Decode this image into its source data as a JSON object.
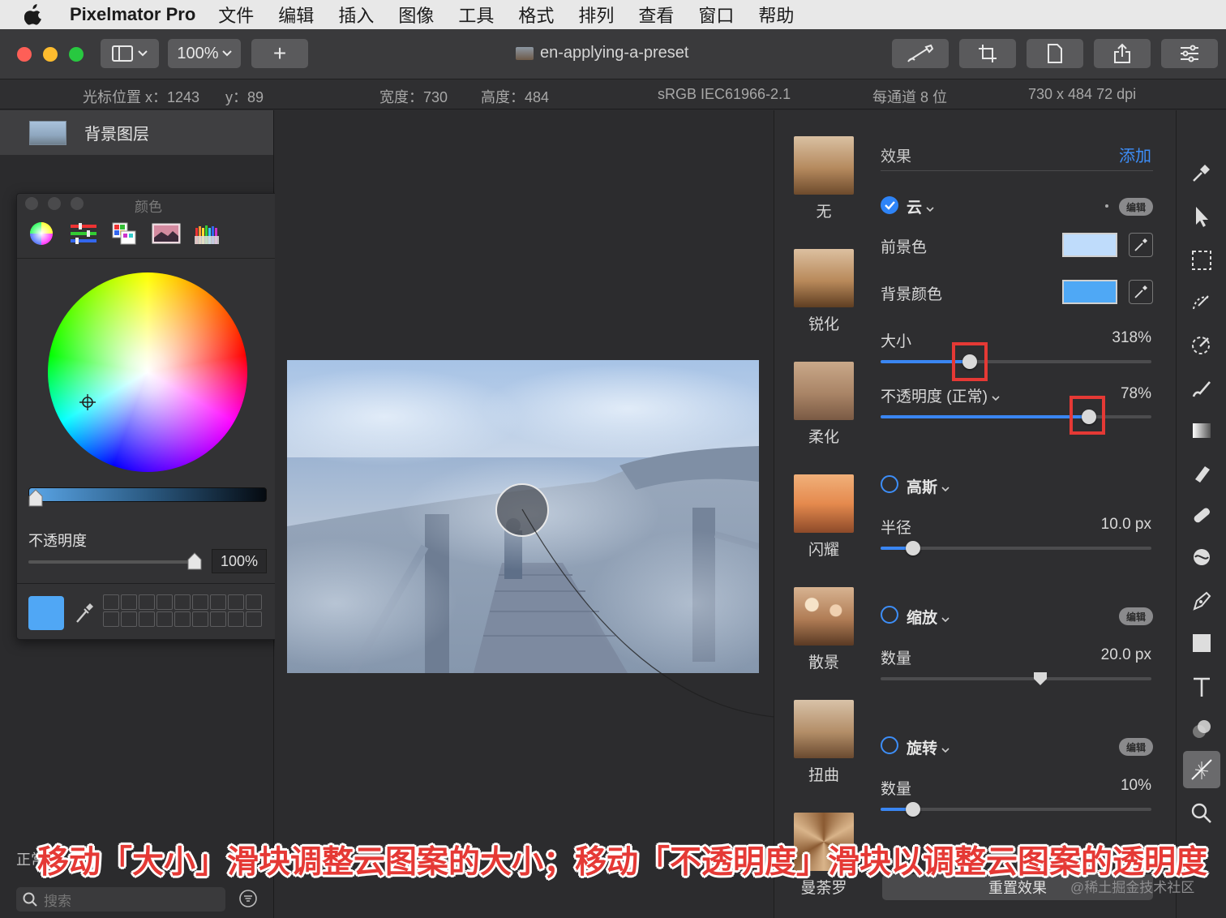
{
  "menubar": {
    "app_name": "Pixelmator Pro",
    "items": [
      "文件",
      "编辑",
      "插入",
      "图像",
      "工具",
      "格式",
      "排列",
      "查看",
      "窗口",
      "帮助"
    ]
  },
  "toolbar": {
    "zoom": "100%",
    "add": "+",
    "doc_title": "en-applying-a-preset"
  },
  "infobar": {
    "cursor_x": "光标位置 x：1243",
    "cursor_y": "y：89",
    "width": "宽度：730",
    "height": "高度：484",
    "profile": "sRGB IEC61966-2.1",
    "bits": "每通道 8 位",
    "dims": "730 x 484 72 dpi"
  },
  "layers": {
    "name": "背景图层",
    "blend_mode_partial": "正常",
    "search_placeholder": "搜索"
  },
  "color_panel": {
    "title": "颜色",
    "opacity_label": "不透明度",
    "opacity_value": "100%",
    "current_color": "#50a7f5"
  },
  "presets": [
    {
      "label": "无"
    },
    {
      "label": "锐化"
    },
    {
      "label": "柔化"
    },
    {
      "label": "闪耀"
    },
    {
      "label": "散景"
    },
    {
      "label": "扭曲"
    },
    {
      "label": "曼荼罗"
    }
  ],
  "effects": {
    "header": "效果",
    "add": "添加",
    "edit": "编辑",
    "clouds": {
      "name": "云",
      "foreground_label": "前景色",
      "foreground_color": "#bfdcfb",
      "background_label": "背景颜色",
      "background_color": "#4fa8f5",
      "size_label": "大小",
      "size_value": "318%",
      "size_fraction": 0.33,
      "opacity_label": "不透明度 (正常)",
      "opacity_value": "78%",
      "opacity_fraction": 0.77
    },
    "gaussian": {
      "name": "高斯",
      "radius_label": "半径",
      "radius_value": "10.0 px",
      "fraction": 0.12
    },
    "zoom": {
      "name": "缩放",
      "amount_label": "数量",
      "amount_value": "20.0 px",
      "fraction": 0.59
    },
    "spin": {
      "name": "旋转",
      "amount_label": "数量",
      "amount_value": "10%",
      "fraction": 0.12
    },
    "reset": "重置效果"
  },
  "caption": "移动「大小」滑块调整云图案的大小；移动「不透明度」滑块以调整云图案的透明度",
  "watermark": "@稀土掘金技术社区",
  "accent_color": "#3a86f2",
  "highlight_color": "#e53935"
}
